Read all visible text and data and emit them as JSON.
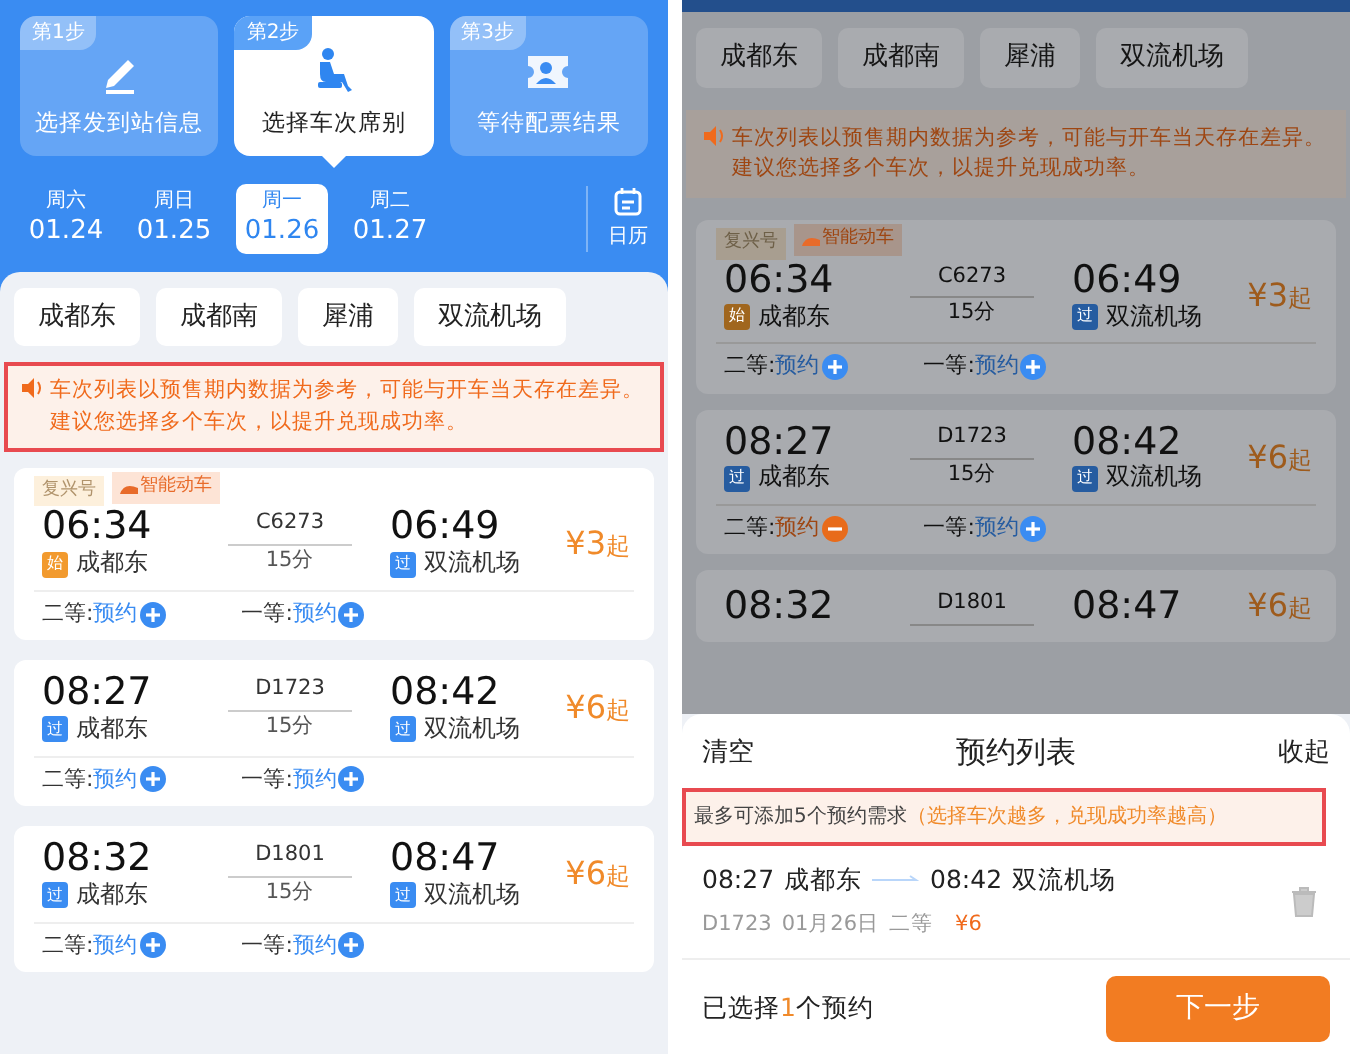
{
  "left": {
    "steps": [
      {
        "badge": "第1步",
        "label": "选择发到站信息",
        "selected": false
      },
      {
        "badge": "第2步",
        "label": "选择车次席别",
        "selected": true
      },
      {
        "badge": "第3步",
        "label": "等待配票结果",
        "selected": false
      }
    ],
    "dates": [
      {
        "weekday": "周六",
        "date": "01.24",
        "selected": false
      },
      {
        "weekday": "周日",
        "date": "01.25",
        "selected": false
      },
      {
        "weekday": "周一",
        "date": "01.26",
        "selected": true
      },
      {
        "weekday": "周二",
        "date": "01.27",
        "selected": false
      }
    ],
    "calendar_label": "日历",
    "stations": [
      "成都东",
      "成都南",
      "犀浦",
      "双流机场"
    ],
    "notice": {
      "lines": [
        "车次列表以预售期内数据为参考，可能与开车当天存在差异。",
        "建议您选择多个车次，以提升兑现成功率。"
      ],
      "highlighted": true
    },
    "trains": [
      {
        "tags": [
          "复兴号",
          "智能动车"
        ],
        "depart_time": "06:34",
        "depart_mark": {
          "text": "始",
          "color": "#f29a2e"
        },
        "depart_station": "成都东",
        "number": "C6273",
        "duration": "15分",
        "arrive_time": "06:49",
        "arrive_mark": {
          "text": "过",
          "color": "#3a8cf2"
        },
        "arrive_station": "双流机场",
        "price": "¥3",
        "price_unit": "起",
        "seats": [
          {
            "label": "二等:",
            "action": "预约",
            "selected": false
          },
          {
            "label": "一等:",
            "action": "预约",
            "selected": false
          }
        ]
      },
      {
        "depart_time": "08:27",
        "depart_mark": {
          "text": "过",
          "color": "#3a8cf2"
        },
        "depart_station": "成都东",
        "number": "D1723",
        "duration": "15分",
        "arrive_time": "08:42",
        "arrive_mark": {
          "text": "过",
          "color": "#3a8cf2"
        },
        "arrive_station": "双流机场",
        "price": "¥6",
        "price_unit": "起",
        "seats": [
          {
            "label": "二等:",
            "action": "预约",
            "selected": false
          },
          {
            "label": "一等:",
            "action": "预约",
            "selected": false
          }
        ]
      },
      {
        "depart_time": "08:32",
        "depart_mark": {
          "text": "过",
          "color": "#3a8cf2"
        },
        "depart_station": "成都东",
        "number": "D1801",
        "duration": "15分",
        "arrive_time": "08:47",
        "arrive_mark": {
          "text": "过",
          "color": "#3a8cf2"
        },
        "arrive_station": "双流机场",
        "price": "¥6",
        "price_unit": "起",
        "seats": [
          {
            "label": "二等:",
            "action": "预约",
            "selected": false
          },
          {
            "label": "一等:",
            "action": "预约",
            "selected": false
          }
        ]
      }
    ]
  },
  "right": {
    "stations": [
      "成都东",
      "成都南",
      "犀浦",
      "双流机场"
    ],
    "notice": {
      "lines": [
        "车次列表以预售期内数据为参考，可能与开车当天存在差异。",
        "建议您选择多个车次，以提升兑现成功率。"
      ],
      "highlighted": false
    },
    "trains": [
      {
        "tags": [
          "复兴号",
          "智能动车"
        ],
        "depart_time": "06:34",
        "depart_mark": {
          "text": "始",
          "color": "#a0661e"
        },
        "depart_station": "成都东",
        "number": "C6273",
        "duration": "15分",
        "arrive_time": "06:49",
        "arrive_mark": {
          "text": "过",
          "color": "#265ca0"
        },
        "arrive_station": "双流机场",
        "price": "¥3",
        "price_unit": "起",
        "seats": [
          {
            "label": "二等:",
            "action": "预约",
            "selected": false
          },
          {
            "label": "一等:",
            "action": "预约",
            "selected": false
          }
        ]
      },
      {
        "depart_time": "08:27",
        "depart_mark": {
          "text": "过",
          "color": "#265ca0"
        },
        "depart_station": "成都东",
        "number": "D1723",
        "duration": "15分",
        "arrive_time": "08:42",
        "arrive_mark": {
          "text": "过",
          "color": "#265ca0"
        },
        "arrive_station": "双流机场",
        "price": "¥6",
        "price_unit": "起",
        "seats": [
          {
            "label": "二等:",
            "action": "预约",
            "selected": true
          },
          {
            "label": "一等:",
            "action": "预约",
            "selected": false
          }
        ]
      },
      {
        "depart_time": "08:32",
        "number": "D1801",
        "arrive_time": "08:47",
        "price": "¥6",
        "price_unit": "起"
      }
    ],
    "sheet": {
      "clear": "清空",
      "title": "预约列表",
      "collapse": "收起",
      "note": "最多可添加5个预约需求",
      "note_hint": "（选择车次越多，兑现成功率越高）",
      "note_highlighted": true,
      "items": [
        {
          "depart_time": "08:27",
          "depart_station": "成都东",
          "arrive_time": "08:42",
          "arrive_station": "双流机场",
          "number": "D1723",
          "date": "01月26日",
          "seat": "二等",
          "price": "¥6"
        }
      ],
      "selected_prefix": "已选择",
      "selected_count": "1",
      "selected_suffix": "个预约",
      "next": "下一步"
    }
  }
}
